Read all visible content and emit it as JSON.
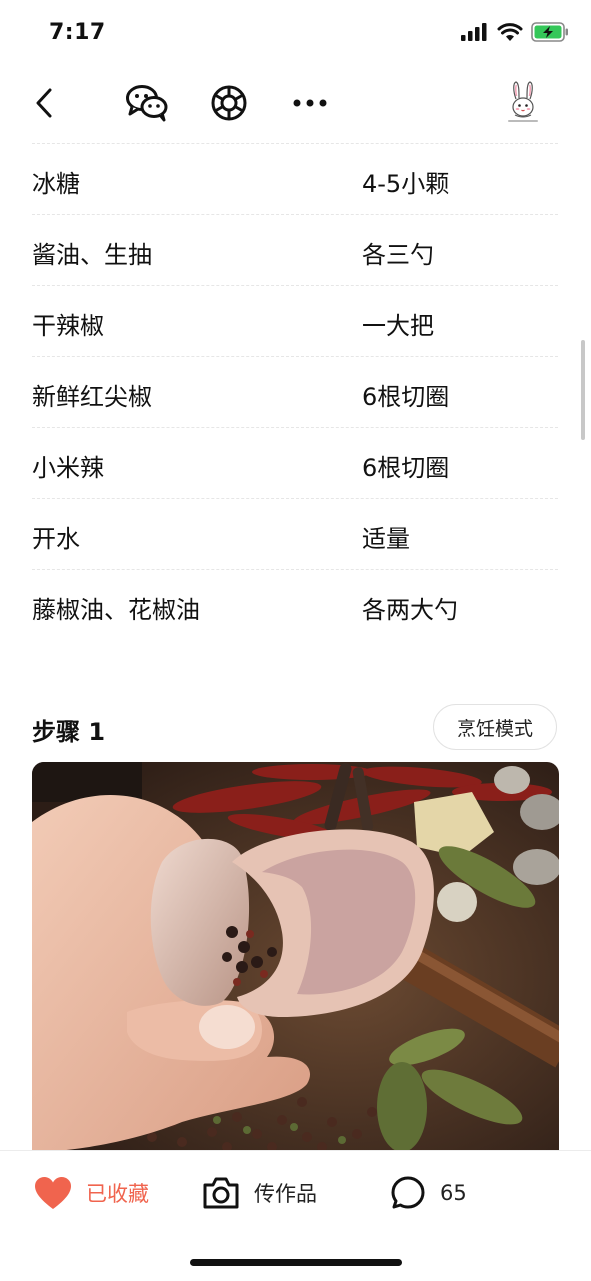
{
  "status": {
    "time": "7:17"
  },
  "nav": {
    "back_icon": "chevron-left-icon",
    "wechat_icon": "wechat-icon",
    "moments_icon": "moments-icon",
    "more_icon": "more-icon",
    "avatar_icon": "rabbit-avatar-icon"
  },
  "ingredients": [
    {
      "name": "冰糖",
      "qty": "4-5小颗"
    },
    {
      "name": "酱油、生抽",
      "qty": "各三勺"
    },
    {
      "name": "干辣椒",
      "qty": "一大把"
    },
    {
      "name": "新鲜红尖椒",
      "qty": "6根切圈"
    },
    {
      "name": "小米辣",
      "qty": "6根切圈"
    },
    {
      "name": "开水",
      "qty": "适量"
    },
    {
      "name": "藤椒油、花椒油",
      "qty": "各两大勺"
    }
  ],
  "step": {
    "title": "步骤 1",
    "cook_mode_label": "烹饪模式"
  },
  "bottom": {
    "favorite_label": "已收藏",
    "upload_label": "传作品",
    "comment_count": "65",
    "accent": "#f0644e"
  }
}
